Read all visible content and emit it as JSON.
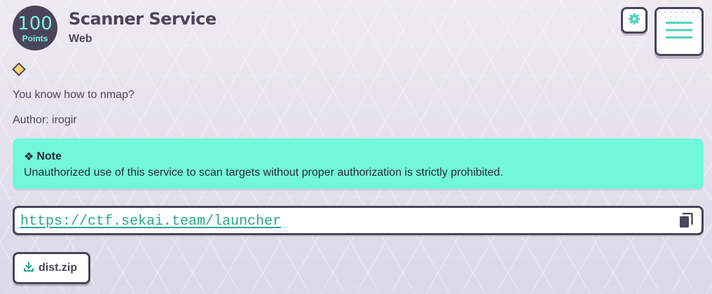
{
  "challenge": {
    "points": "100",
    "points_label": "Points",
    "title": "Scanner Service",
    "category": "Web",
    "description": "You know how to nmap?",
    "author": "Author: irogir"
  },
  "note": {
    "icon": "❖",
    "title": "Note",
    "text": "Unauthorized use of this service to scan targets without proper authorization is strictly prohibited."
  },
  "link": {
    "url": "https://ctf.sekai.team/launcher",
    "copy_icon": "copy-icon"
  },
  "attachment": {
    "filename": "dist.zip",
    "icon": "download-icon"
  },
  "toolbar": {
    "settings_icon": "gear-icon",
    "menu_icon": "hamburger-menu-icon"
  },
  "colors": {
    "accent": "#72f8d9",
    "accent_text": "#2aa58f",
    "dark": "#4a4559",
    "difficulty_diamond": "#f5d76e"
  }
}
